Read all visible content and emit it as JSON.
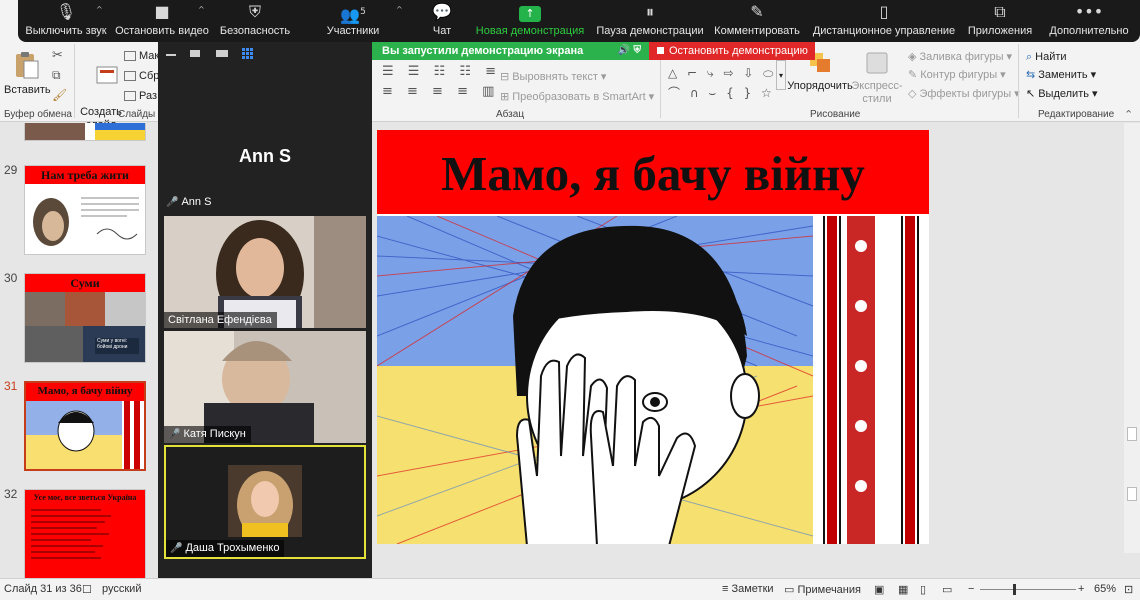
{
  "zoom_toolbar": {
    "items": [
      {
        "label": "Выключить звук",
        "icon": "mic-icon"
      },
      {
        "label": "Остановить видео",
        "icon": "video-camera-icon"
      },
      {
        "label": "Безопасность",
        "icon": "shield-icon"
      },
      {
        "label": "Участники",
        "icon": "participants-icon",
        "badge": "5"
      },
      {
        "label": "Чат",
        "icon": "chat-icon"
      },
      {
        "label": "Новая демонстрация",
        "icon": "share-screen-icon"
      },
      {
        "label": "Пауза демонстрации",
        "icon": "pause-icon"
      },
      {
        "label": "Комментировать",
        "icon": "pen-icon"
      },
      {
        "label": "Дистанционное управление",
        "icon": "mouse-icon"
      },
      {
        "label": "Приложения",
        "icon": "apps-icon"
      },
      {
        "label": "Дополнительно",
        "icon": "more-icon"
      }
    ],
    "accent_green": "#2ecc40"
  },
  "share_bar": {
    "status_text": "Вы запустили демонстрацию экрана",
    "stop_label": "Остановить демонстрацию"
  },
  "ribbon": {
    "paste_label": "Вставить",
    "create_slide_label": "Создать\nслайд",
    "slide_menu_items": [
      "Мак",
      "Сбр",
      "Раз"
    ],
    "text_direction_label": "",
    "align_text_label": "Выровнять текст",
    "smartart_label": "Преобразовать в SmartArt",
    "arrange_label": "Упорядочить",
    "quick_styles_label": "Экспресс-\nстили",
    "shape_fill_label": "Заливка фигуры",
    "shape_outline_label": "Контур фигуры",
    "shape_effects_label": "Эффекты фигуры",
    "find_label": "Найти",
    "replace_label": "Заменить",
    "select_label": "Выделить",
    "groups": {
      "clipboard": "Буфер обмена",
      "slides": "Слайды",
      "paragraph": "Абзац",
      "drawing": "Рисование",
      "editing": "Редактирование"
    }
  },
  "gallery": {
    "host_name": "Ann S",
    "host_label": "Ann S",
    "participants": [
      {
        "name": "Світлана Ефендієва"
      },
      {
        "name": "Катя Пискун"
      },
      {
        "name": "Даша Трохыменко"
      }
    ]
  },
  "thumbnails": [
    {
      "number": "29",
      "title": "Нам треба жити"
    },
    {
      "number": "30",
      "title": "Суми",
      "caption": "Суми у вогні: бойові дрони"
    },
    {
      "number": "31",
      "title": "Мамо, я бачу війну"
    },
    {
      "number": "32",
      "title": "Усе моє, все зветься Україна"
    }
  ],
  "slide": {
    "title": "Мамо, я бачу війну",
    "title_band_color": "#ff0000"
  },
  "statusbar": {
    "slide_counter": "Слайд 31 из 36",
    "language": "русский",
    "notes_label": "Заметки",
    "comments_label": "Примечания",
    "zoom_level": "65%"
  }
}
